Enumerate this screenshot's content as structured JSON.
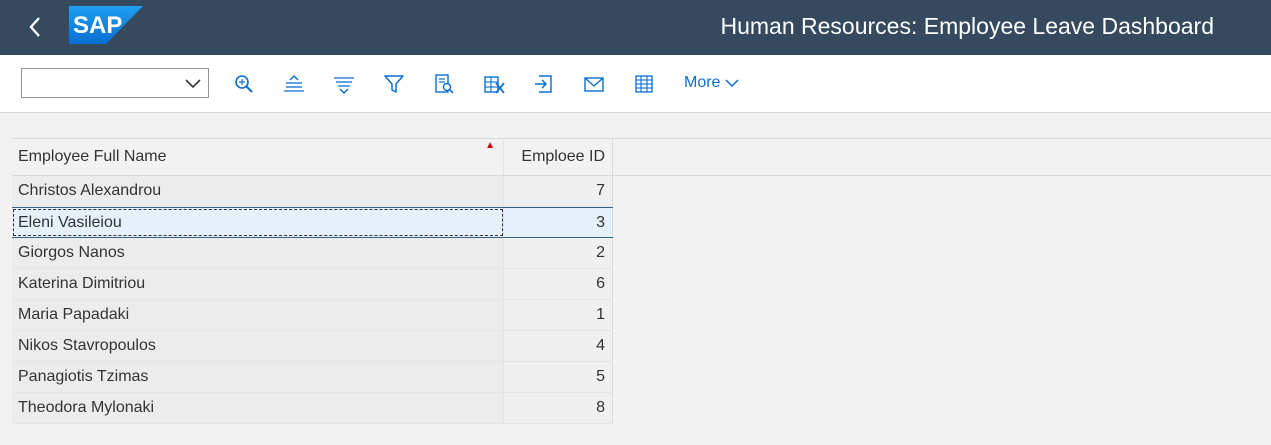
{
  "shell": {
    "title": "Human Resources: Employee Leave Dashboard",
    "logo_text": "SAP",
    "brand_color": "#0a6ed1"
  },
  "toolbar": {
    "variant_value": "",
    "icons": [
      "search-icon",
      "sort-ascending-icon",
      "sort-descending-icon",
      "filter-icon",
      "find-icon",
      "export-excel-icon",
      "export-icon",
      "mail-icon",
      "spreadsheet-icon"
    ],
    "more_label": "More"
  },
  "grid": {
    "columns": [
      "Employee Full Name",
      "Emploee ID"
    ],
    "rows": [
      {
        "name": "Christos Alexandrou",
        "id": "7"
      },
      {
        "name": "Eleni Vasileiou",
        "id": "3"
      },
      {
        "name": "Giorgos Nanos",
        "id": "2"
      },
      {
        "name": "Katerina Dimitriou",
        "id": "6"
      },
      {
        "name": "Maria Papadaki",
        "id": "1"
      },
      {
        "name": "Nikos Stavropoulos",
        "id": "4"
      },
      {
        "name": "Panagiotis Tzimas",
        "id": "5"
      },
      {
        "name": "Theodora Mylonaki",
        "id": "8"
      }
    ],
    "selected_row": 1,
    "sort_color": "#cc0000"
  }
}
